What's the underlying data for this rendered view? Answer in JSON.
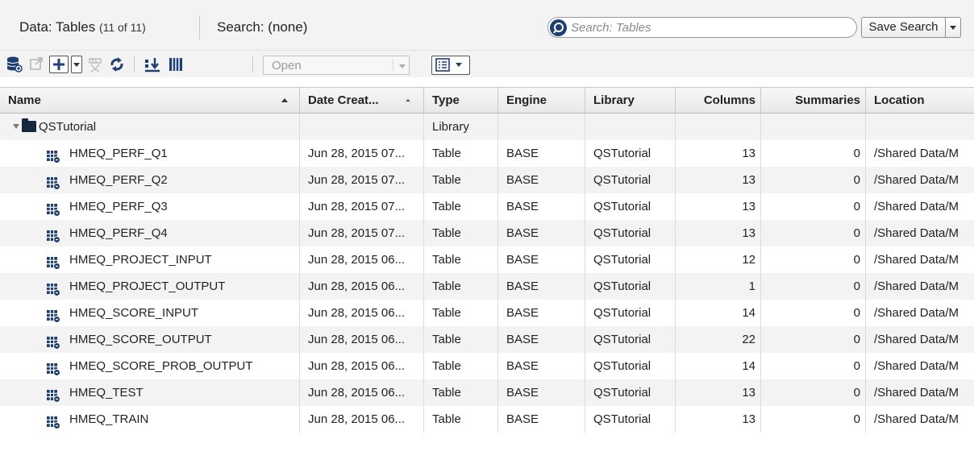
{
  "header": {
    "title": "Data: Tables",
    "count": "(11 of 11)",
    "search_status": "Search: (none)",
    "search_placeholder": "Search: Tables",
    "save_search_label": "Save Search"
  },
  "toolbar": {
    "open_select_value": "Open",
    "icons": [
      "database-icon",
      "open-external-icon",
      "add-button",
      "add-dropdown",
      "filter-icon",
      "refresh-icon",
      "import-icon",
      "columns-icon",
      "view-options-icon"
    ]
  },
  "table": {
    "columns": {
      "name": "Name",
      "date": "Date Creat...",
      "type": "Type",
      "engine": "Engine",
      "library": "Library",
      "columns": "Columns",
      "summaries": "Summaries",
      "location": "Location"
    },
    "folder": {
      "name": "QSTutorial",
      "type": "Library"
    },
    "rows": [
      {
        "name": "HMEQ_PERF_Q1",
        "date": "Jun 28, 2015 07...",
        "type": "Table",
        "engine": "BASE",
        "library": "QSTutorial",
        "columns": "13",
        "summaries": "0",
        "location": "/Shared Data/M"
      },
      {
        "name": "HMEQ_PERF_Q2",
        "date": "Jun 28, 2015 07...",
        "type": "Table",
        "engine": "BASE",
        "library": "QSTutorial",
        "columns": "13",
        "summaries": "0",
        "location": "/Shared Data/M"
      },
      {
        "name": "HMEQ_PERF_Q3",
        "date": "Jun 28, 2015 07...",
        "type": "Table",
        "engine": "BASE",
        "library": "QSTutorial",
        "columns": "13",
        "summaries": "0",
        "location": "/Shared Data/M"
      },
      {
        "name": "HMEQ_PERF_Q4",
        "date": "Jun 28, 2015 07...",
        "type": "Table",
        "engine": "BASE",
        "library": "QSTutorial",
        "columns": "13",
        "summaries": "0",
        "location": "/Shared Data/M"
      },
      {
        "name": "HMEQ_PROJECT_INPUT",
        "date": "Jun 28, 2015 06...",
        "type": "Table",
        "engine": "BASE",
        "library": "QSTutorial",
        "columns": "12",
        "summaries": "0",
        "location": "/Shared Data/M"
      },
      {
        "name": "HMEQ_PROJECT_OUTPUT",
        "date": "Jun 28, 2015 06...",
        "type": "Table",
        "engine": "BASE",
        "library": "QSTutorial",
        "columns": "1",
        "summaries": "0",
        "location": "/Shared Data/M"
      },
      {
        "name": "HMEQ_SCORE_INPUT",
        "date": "Jun 28, 2015 06...",
        "type": "Table",
        "engine": "BASE",
        "library": "QSTutorial",
        "columns": "14",
        "summaries": "0",
        "location": "/Shared Data/M"
      },
      {
        "name": "HMEQ_SCORE_OUTPUT",
        "date": "Jun 28, 2015 06...",
        "type": "Table",
        "engine": "BASE",
        "library": "QSTutorial",
        "columns": "22",
        "summaries": "0",
        "location": "/Shared Data/M"
      },
      {
        "name": "HMEQ_SCORE_PROB_OUTPUT",
        "date": "Jun 28, 2015 06...",
        "type": "Table",
        "engine": "BASE",
        "library": "QSTutorial",
        "columns": "14",
        "summaries": "0",
        "location": "/Shared Data/M"
      },
      {
        "name": "HMEQ_TEST",
        "date": "Jun 28, 2015 06...",
        "type": "Table",
        "engine": "BASE",
        "library": "QSTutorial",
        "columns": "13",
        "summaries": "0",
        "location": "/Shared Data/M"
      },
      {
        "name": "HMEQ_TRAIN",
        "date": "Jun 28, 2015 06...",
        "type": "Table",
        "engine": "BASE",
        "library": "QSTutorial",
        "columns": "13",
        "summaries": "0",
        "location": "/Shared Data/M"
      }
    ]
  },
  "colors": {
    "header_bg": "#f3f3f3",
    "icon_navy": "#1d3f73",
    "folder_navy": "#14283f",
    "row_alt": "#f3f3f3"
  }
}
